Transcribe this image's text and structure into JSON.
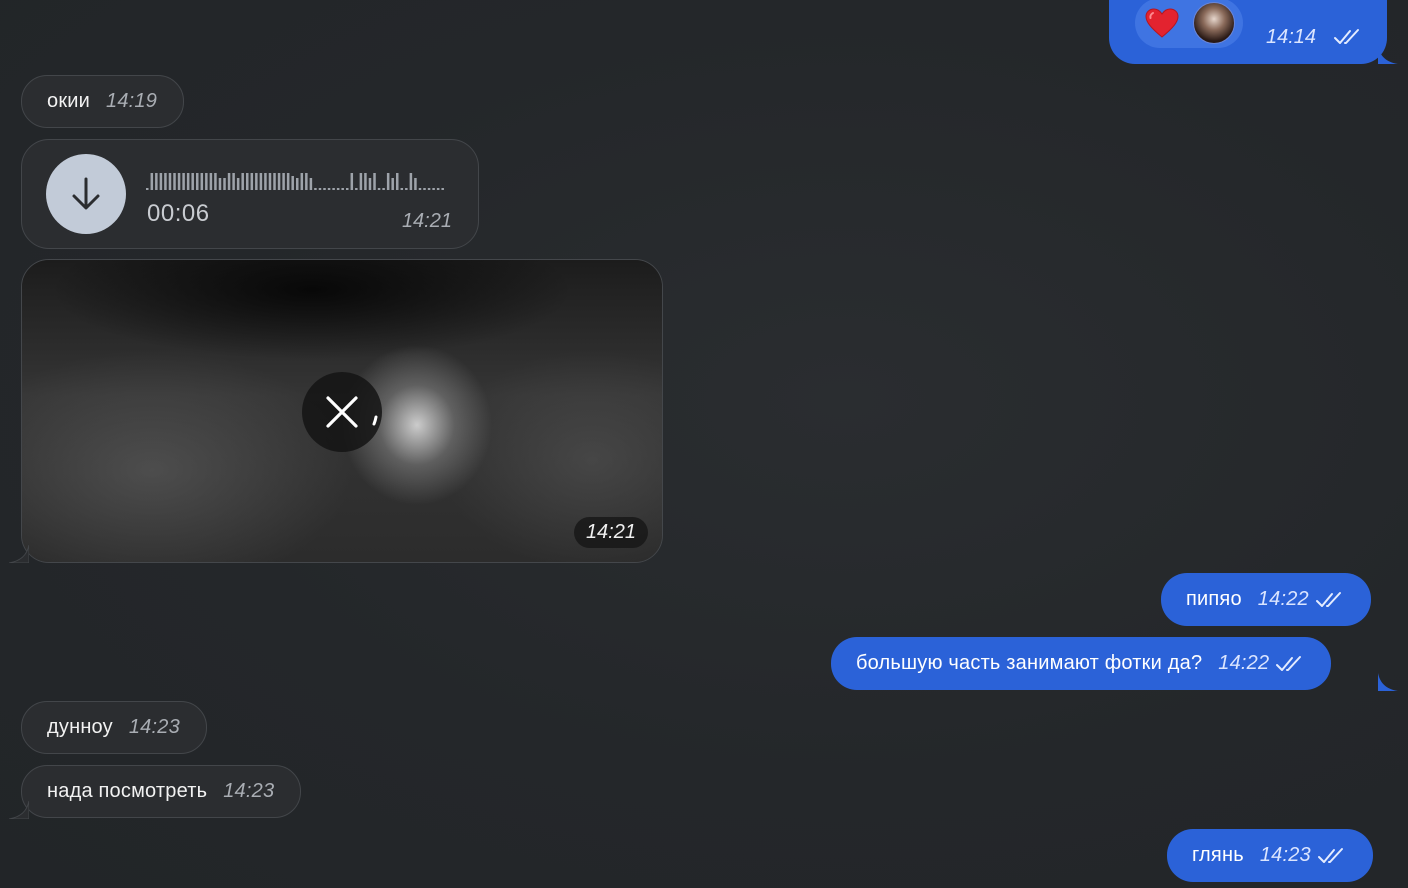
{
  "colors": {
    "background": "#24272a",
    "incoming_bubble": "#2b2d30",
    "outgoing_bubble": "#2b62d8",
    "timestamp_in": "#a9adb3",
    "timestamp_out": "#dbe5ff",
    "voice_button": "#c2cbd8"
  },
  "messages": {
    "m0": {
      "direction": "outgoing",
      "reaction": "heart-icon",
      "time": "14:14",
      "status": "read"
    },
    "m1": {
      "direction": "incoming",
      "text": "окии",
      "time": "14:19"
    },
    "m2": {
      "direction": "incoming",
      "type": "voice",
      "duration": "00:06",
      "time": "14:21"
    },
    "m3": {
      "direction": "incoming",
      "type": "media",
      "state": "loading",
      "time": "14:21"
    },
    "m4": {
      "direction": "outgoing",
      "text": "пипяо",
      "time": "14:22",
      "status": "read"
    },
    "m5": {
      "direction": "outgoing",
      "text": "большую часть занимают фотки да?",
      "time": "14:22",
      "status": "read"
    },
    "m6": {
      "direction": "incoming",
      "text": "дунноу",
      "time": "14:23"
    },
    "m7": {
      "direction": "incoming",
      "text": "нада посмотреть",
      "time": "14:23"
    },
    "m8": {
      "direction": "outgoing",
      "text": "глянь",
      "time": "14:23",
      "status": "read"
    }
  }
}
